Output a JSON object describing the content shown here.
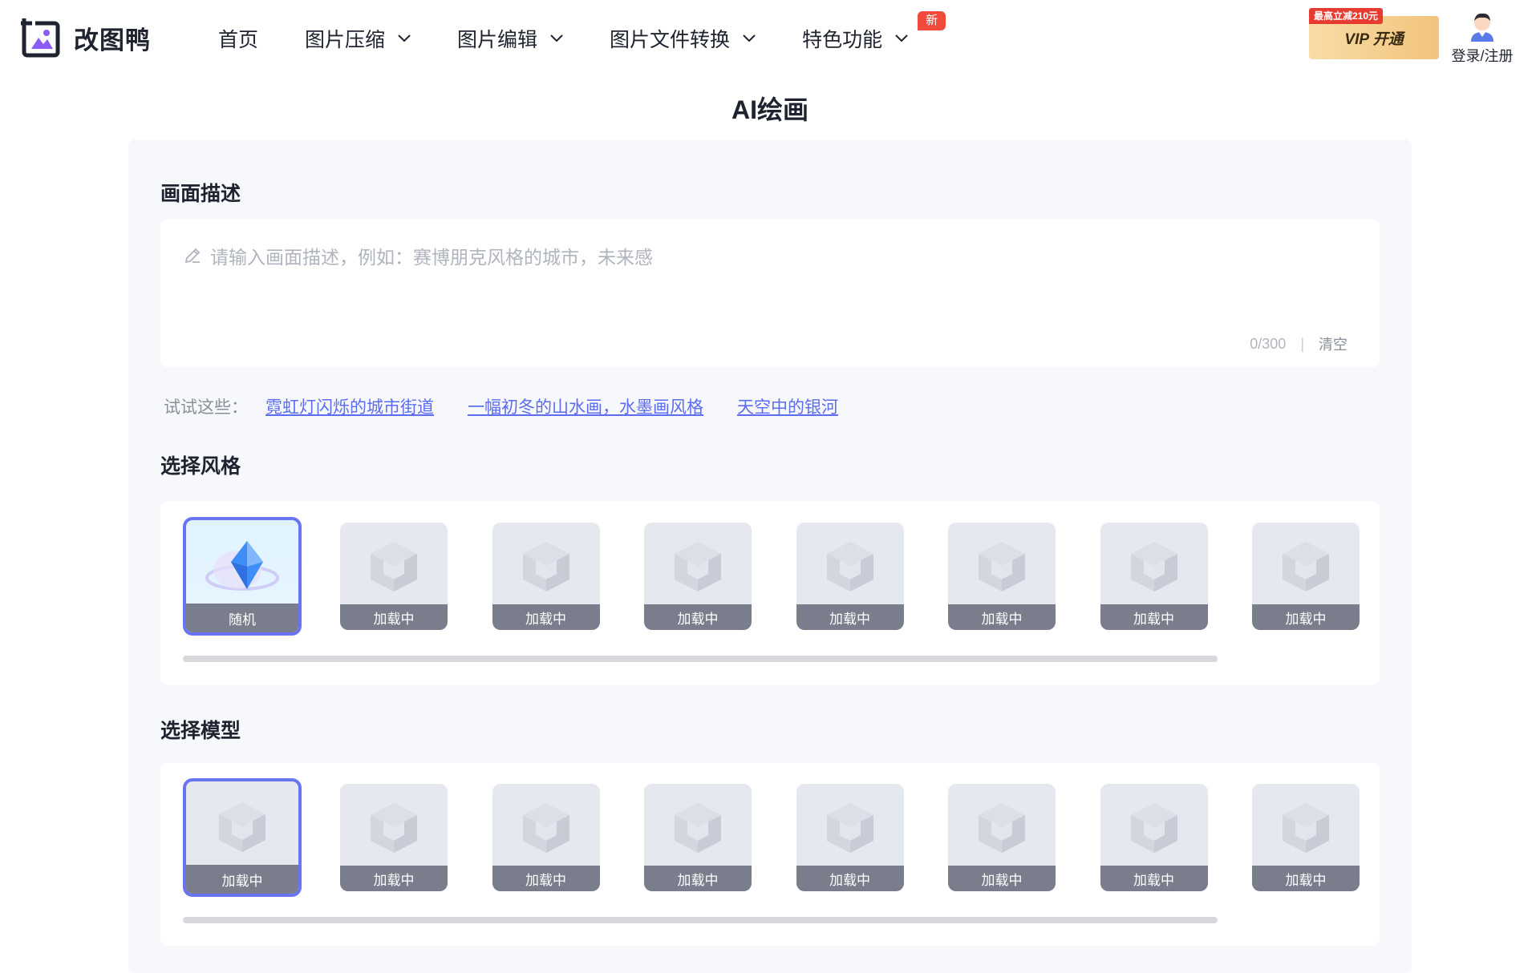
{
  "header": {
    "logo_text": "改图鸭",
    "nav": [
      {
        "label": "首页",
        "dropdown": false
      },
      {
        "label": "图片压缩",
        "dropdown": true
      },
      {
        "label": "图片编辑",
        "dropdown": true
      },
      {
        "label": "图片文件转换",
        "dropdown": true
      },
      {
        "label": "特色功能",
        "dropdown": true,
        "badge": "新"
      }
    ],
    "vip_tag": "最高立减210元",
    "vip_label": "VIP 开通",
    "login_label": "登录/注册"
  },
  "page_title": "AI绘画",
  "description": {
    "title": "画面描述",
    "placeholder": "请输入画面描述，例如：赛博朋克风格的城市，未来感",
    "counter": "0/300",
    "separator": "|",
    "clear_label": "清空"
  },
  "suggestions": {
    "label": "试试这些：",
    "items": [
      "霓虹灯闪烁的城市街道",
      "一幅初冬的山水画，水墨画风格",
      "天空中的银河"
    ]
  },
  "style": {
    "title": "选择风格",
    "items": [
      "随机",
      "加载中",
      "加载中",
      "加载中",
      "加载中",
      "加载中",
      "加载中",
      "加载中"
    ]
  },
  "model": {
    "title": "选择模型",
    "items": [
      "加载中",
      "加载中",
      "加载中",
      "加载中",
      "加载中",
      "加载中",
      "加载中",
      "加载中"
    ]
  },
  "colors": {
    "accent": "#6874f2",
    "link": "#5b6cf0",
    "badge_red": "#f04b3a",
    "panel_bg": "#f7f8fc"
  }
}
